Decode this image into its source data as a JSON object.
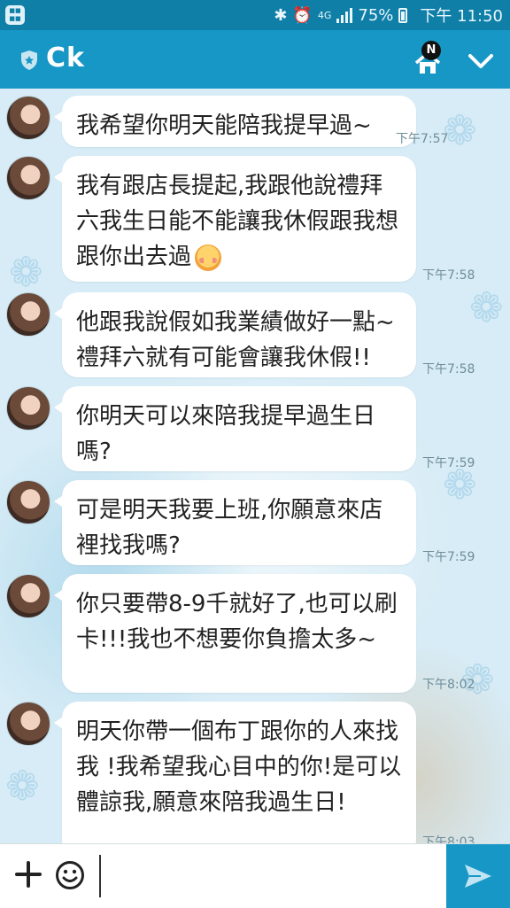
{
  "status_bar": {
    "network": "4G",
    "battery": "75%",
    "time": "下午 11:50"
  },
  "header": {
    "contact_name": "Ck",
    "notification_badge": "N",
    "icons": [
      "shield-icon",
      "home-icon",
      "chevron-down-icon"
    ]
  },
  "messages": [
    {
      "text": "我希望你明天能陪我提早過~",
      "time": "下午7:57"
    },
    {
      "text": "我有跟店長提起,我跟他說禮拜六我生日能不能讓我休假跟我想跟你出去過",
      "emoji": "blushing-face",
      "time": "下午7:58"
    },
    {
      "text": "他跟我說假如我業績做好一點~禮拜六就有可能會讓我休假!!",
      "time": "下午7:58"
    },
    {
      "text": "你明天可以來陪我提早過生日嗎?",
      "time": "下午7:59"
    },
    {
      "text": "可是明天我要上班,你願意來店裡找我嗎?",
      "time": "下午7:59"
    },
    {
      "text": "你只要帶8-9千就好了,也可以刷卡!!!我也不想要你負擔太多~",
      "time": "下午8:02"
    },
    {
      "text": "明天你帶一個布丁跟你的人來找我 !我希望我心目中的你!是可以體諒我,願意來陪我過生日!",
      "time": "下午8:03"
    }
  ],
  "input_bar": {
    "message_value": "",
    "icons": [
      "plus-icon",
      "smiley-icon",
      "send-icon"
    ]
  },
  "colors": {
    "header": "#1797c6",
    "status_bar": "#0f7fa8",
    "bubble": "#ffffff",
    "send_button": "#1797c6"
  }
}
